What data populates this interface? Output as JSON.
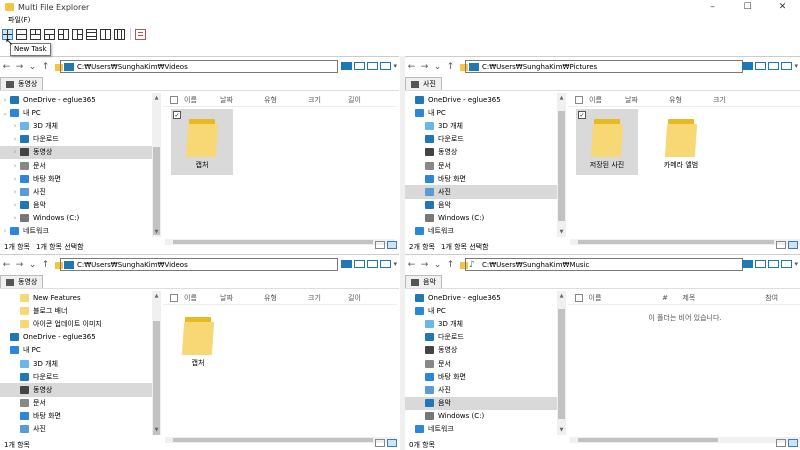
{
  "window": {
    "title": "Multi File Explorer",
    "minimize": "–",
    "maximize": "☐",
    "close": "✕"
  },
  "menu": {
    "file": "파일(F)"
  },
  "toolbar": {
    "tooltip": "New Task"
  },
  "nav": {
    "back": "←",
    "forward": "→",
    "dropdown": "⌄",
    "up": "↑",
    "more": "▾"
  },
  "icons": {
    "chevron": "›",
    "chevron_open": "⌄",
    "check": "✓"
  },
  "colors": {
    "accent": "#1f78b4",
    "folder": "#f8d775",
    "selection": "#d9d9d9"
  },
  "panes": [
    {
      "address": "C:₩Users₩SunghaKim₩Videos",
      "tab": "동영상",
      "columns": [
        "이름",
        "날짜",
        "유형",
        "크기",
        "길이"
      ],
      "tree": [
        {
          "label": "OneDrive - eglue365",
          "icon": "cloud-icon",
          "chevron": "›"
        },
        {
          "label": "내 PC",
          "icon": "pc-icon",
          "chevron": "⌄"
        },
        {
          "label": "3D 개체",
          "icon": "cube-icon",
          "chevron": "›",
          "indent": true
        },
        {
          "label": "다운로드",
          "icon": "download-icon",
          "chevron": "›",
          "indent": true
        },
        {
          "label": "동영상",
          "icon": "video-icon",
          "chevron": "›",
          "indent": true,
          "selected": true
        },
        {
          "label": "문서",
          "icon": "document-icon",
          "chevron": "›",
          "indent": true
        },
        {
          "label": "바탕 화면",
          "icon": "desktop-icon",
          "chevron": "›",
          "indent": true
        },
        {
          "label": "사진",
          "icon": "picture-icon",
          "chevron": "›",
          "indent": true
        },
        {
          "label": "음악",
          "icon": "music-icon",
          "chevron": "›",
          "indent": true
        },
        {
          "label": "Windows (C:)",
          "icon": "drive-icon",
          "chevron": "›",
          "indent": true
        },
        {
          "label": "네트워크",
          "icon": "network-icon",
          "chevron": "›"
        }
      ],
      "files": [
        {
          "label": "캡처",
          "selected": true
        }
      ],
      "status": {
        "count": "1개 항목",
        "selected": "1개 항목 선택함"
      }
    },
    {
      "address": "C:₩Users₩SunghaKim₩Pictures",
      "tab": "사진",
      "columns": [
        "이름",
        "날짜",
        "유형",
        "크기"
      ],
      "tree": [
        {
          "label": "OneDrive - eglue365",
          "icon": "cloud-icon",
          "chevron": ""
        },
        {
          "label": "내 PC",
          "icon": "pc-icon",
          "chevron": ""
        },
        {
          "label": "3D 개체",
          "icon": "cube-icon",
          "chevron": "",
          "indent": true
        },
        {
          "label": "다운로드",
          "icon": "download-icon",
          "chevron": "",
          "indent": true
        },
        {
          "label": "동영상",
          "icon": "video-icon",
          "chevron": "",
          "indent": true
        },
        {
          "label": "문서",
          "icon": "document-icon",
          "chevron": "",
          "indent": true
        },
        {
          "label": "바탕 화면",
          "icon": "desktop-icon",
          "chevron": "",
          "indent": true
        },
        {
          "label": "사진",
          "icon": "picture-icon",
          "chevron": "",
          "indent": true,
          "selected": true
        },
        {
          "label": "음악",
          "icon": "music-icon",
          "chevron": "",
          "indent": true
        },
        {
          "label": "Windows (C:)",
          "icon": "drive-icon",
          "chevron": "",
          "indent": true
        },
        {
          "label": "네트워크",
          "icon": "network-icon",
          "chevron": ""
        }
      ],
      "files": [
        {
          "label": "저장된 사진",
          "selected": true
        },
        {
          "label": "카메라 앨범",
          "selected": false
        }
      ],
      "status": {
        "count": "2개 항목",
        "selected": "1개 항목 선택함"
      }
    },
    {
      "address": "C:₩Users₩SunghaKim₩Videos",
      "tab": "동영상",
      "columns": [
        "이름",
        "날짜",
        "유형",
        "크기",
        "길이"
      ],
      "tree": [
        {
          "label": "New Features",
          "icon": "folder-icon",
          "chevron": "",
          "indent": true
        },
        {
          "label": "블로그 배너",
          "icon": "folder-icon",
          "chevron": "",
          "indent": true
        },
        {
          "label": "아이콘 업데이트 이미지",
          "icon": "folder-icon",
          "chevron": "",
          "indent": true
        },
        {
          "label": "OneDrive - eglue365",
          "icon": "cloud-icon",
          "chevron": ""
        },
        {
          "label": "내 PC",
          "icon": "pc-icon",
          "chevron": ""
        },
        {
          "label": "3D 개체",
          "icon": "cube-icon",
          "chevron": "",
          "indent": true
        },
        {
          "label": "다운로드",
          "icon": "download-icon",
          "chevron": "",
          "indent": true
        },
        {
          "label": "동영상",
          "icon": "video-icon",
          "chevron": "",
          "indent": true,
          "selected": true
        },
        {
          "label": "문서",
          "icon": "document-icon",
          "chevron": "",
          "indent": true
        },
        {
          "label": "바탕 화면",
          "icon": "desktop-icon",
          "chevron": "",
          "indent": true
        },
        {
          "label": "사진",
          "icon": "picture-icon",
          "chevron": "",
          "indent": true
        }
      ],
      "files": [
        {
          "label": "캡처",
          "selected": false
        }
      ],
      "status": {
        "count": "1개 항목",
        "selected": ""
      }
    },
    {
      "address": "C:₩Users₩SunghaKim₩Music",
      "tab": "음악",
      "columns": [
        "이름",
        "#",
        "제목",
        "참여"
      ],
      "tree": [
        {
          "label": "OneDrive - eglue365",
          "icon": "cloud-icon",
          "chevron": ""
        },
        {
          "label": "내 PC",
          "icon": "pc-icon",
          "chevron": ""
        },
        {
          "label": "3D 개체",
          "icon": "cube-icon",
          "chevron": "",
          "indent": true
        },
        {
          "label": "다운로드",
          "icon": "download-icon",
          "chevron": "",
          "indent": true
        },
        {
          "label": "동영상",
          "icon": "video-icon",
          "chevron": "",
          "indent": true
        },
        {
          "label": "문서",
          "icon": "document-icon",
          "chevron": "",
          "indent": true
        },
        {
          "label": "바탕 화면",
          "icon": "desktop-icon",
          "chevron": "",
          "indent": true
        },
        {
          "label": "사진",
          "icon": "picture-icon",
          "chevron": "",
          "indent": true
        },
        {
          "label": "음악",
          "icon": "music-icon",
          "chevron": "",
          "indent": true,
          "selected": true
        },
        {
          "label": "Windows (C:)",
          "icon": "drive-icon",
          "chevron": "",
          "indent": true
        },
        {
          "label": "네트워크",
          "icon": "network-icon",
          "chevron": ""
        }
      ],
      "files": [],
      "empty_message": "이 폴더는 비어 있습니다.",
      "status": {
        "count": "0개 항목",
        "selected": ""
      }
    }
  ]
}
